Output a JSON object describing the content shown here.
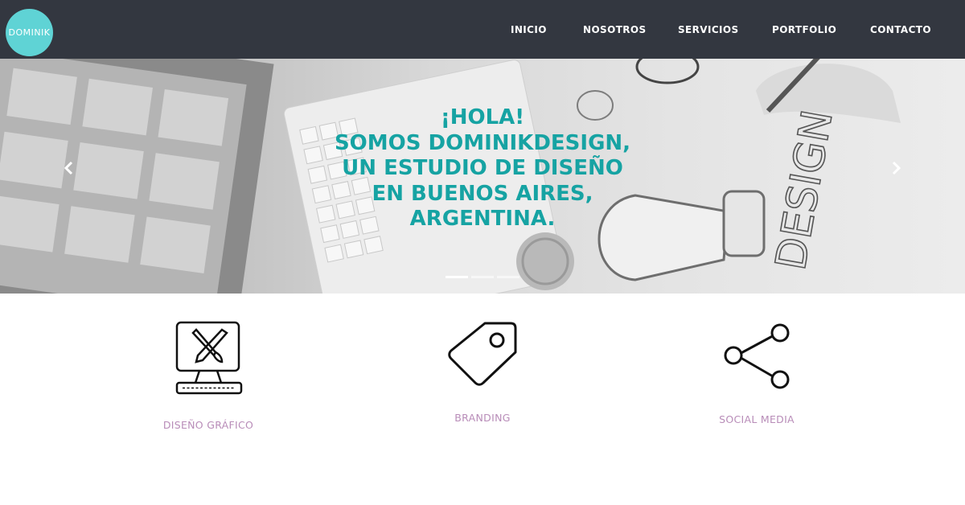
{
  "brand": {
    "logo_text": "DOMINIK",
    "accent": "#5fd3d5",
    "header_bg": "#333740"
  },
  "nav": {
    "items": [
      {
        "label": "INICIO"
      },
      {
        "label": "NOSOTROS"
      },
      {
        "label": "SERVICIOS"
      },
      {
        "label": "PORTFOLIO"
      },
      {
        "label": "CONTACTO"
      }
    ]
  },
  "hero": {
    "lines": [
      "¡HOLA!",
      "SOMOS DOMINIKDESIGN,",
      "UN ESTUDIO DE DISEÑO",
      "EN BUENOS AIRES,",
      "ARGENTINA."
    ],
    "image_word": "DESIGN",
    "text_color": "#16a3a3",
    "slide_count": 3,
    "active_slide": 1,
    "prev_icon": "chevron-left-icon",
    "next_icon": "chevron-right-icon"
  },
  "services": [
    {
      "label": "DISEÑO GRÁFICO",
      "icon": "monitor-brush-pencil-icon"
    },
    {
      "label": "BRANDING",
      "icon": "tag-icon"
    },
    {
      "label": "SOCIAL MEDIA",
      "icon": "share-icon"
    }
  ],
  "label_color": "#b88cb8"
}
